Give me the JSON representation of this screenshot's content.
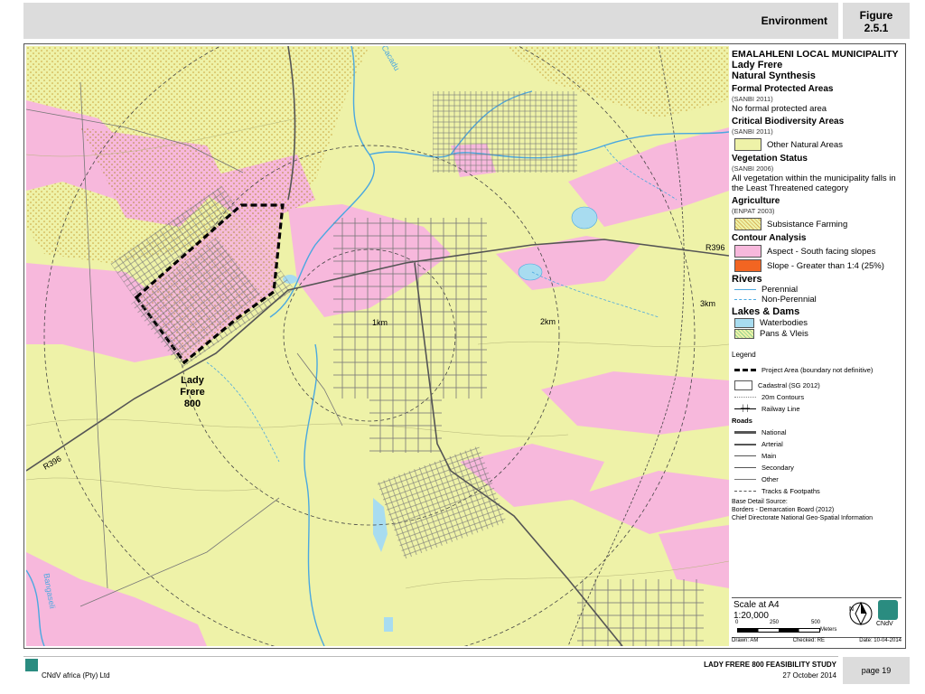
{
  "header": {
    "section": "Environment",
    "figure_label": "Figure",
    "figure_number": "2.5.1"
  },
  "legend": {
    "municipality": "EMALAHLENI LOCAL MUNICIPALITY",
    "project": "Lady Frere",
    "subtitle": "Natural Synthesis",
    "protected_title": "Formal Protected Areas",
    "protected_src": "(SANBI 2011)",
    "protected_note": "No formal protected area",
    "cba_title": "Critical Biodiversity Areas",
    "cba_src": "(SANBI 2011)",
    "cba_item": "Other Natural Areas",
    "veg_title": "Vegetation Status",
    "veg_src": "(SANBI 2006)",
    "veg_note": "All vegetation within the municipality falls in the Least Threatened category",
    "agri_title": "Agriculture",
    "agri_src": "(ENPAT 2003)",
    "agri_item": "Subsistance Farming",
    "contour_title": "Contour Analysis",
    "contour_item1": "Aspect - South facing slopes",
    "contour_item2": "Slope - Greater than 1:4 (25%)",
    "rivers_title": "Rivers",
    "river1": "Perennial",
    "river2": "Non-Perennial",
    "lakes_title": "Lakes & Dams",
    "lake1": "Waterbodies",
    "lake2": "Pans & Vleis",
    "legend_title": "Legend",
    "project_area": "Project Area (boundary not definitive)",
    "cadastral": "Cadastral (SG 2012)",
    "contours": "20m Contours",
    "railway": "Railway Line",
    "roads_title": "Roads",
    "road_national": "National",
    "road_arterial": "Arterial",
    "road_main": "Main",
    "road_secondary": "Secondary",
    "road_other": "Other",
    "road_tracks": "Tracks & Footpaths",
    "base_src1": "Base Detail Source:",
    "base_src2": "Borders - Demarcation Board (2012)",
    "base_src3": "Chief Directorate National Geo-Spatial Information"
  },
  "scale": {
    "label": "Scale at A4",
    "ratio": "1:20,000",
    "tick0": "0",
    "tick1": "250",
    "tick2": "500",
    "unit": "Meters",
    "drawn": "Drawn: AM",
    "checked": "Checked: RE",
    "date": "Date: 10-04-2014",
    "company": "CNdV"
  },
  "map": {
    "road_label_1": "R396",
    "road_label_2": "R396",
    "ring_1km": "1km",
    "ring_2km": "2km",
    "ring_3km": "3km",
    "place_line1": "Lady",
    "place_line2": "Frere",
    "place_line3": "800",
    "river_label_1": "Cacadu",
    "river_label_2": "Bangaseli"
  },
  "footer": {
    "company": "CNdV africa (Pty) Ltd",
    "study": "LADY FRERE 800 FEASIBILITY STUDY",
    "date": "27 October 2014",
    "page": "page 19"
  },
  "colors": {
    "natural": "#eef2a8",
    "aspect": "#f7b8dc",
    "slope": "#f26522",
    "water": "#a8dcf0",
    "river": "#4aa8e0"
  }
}
